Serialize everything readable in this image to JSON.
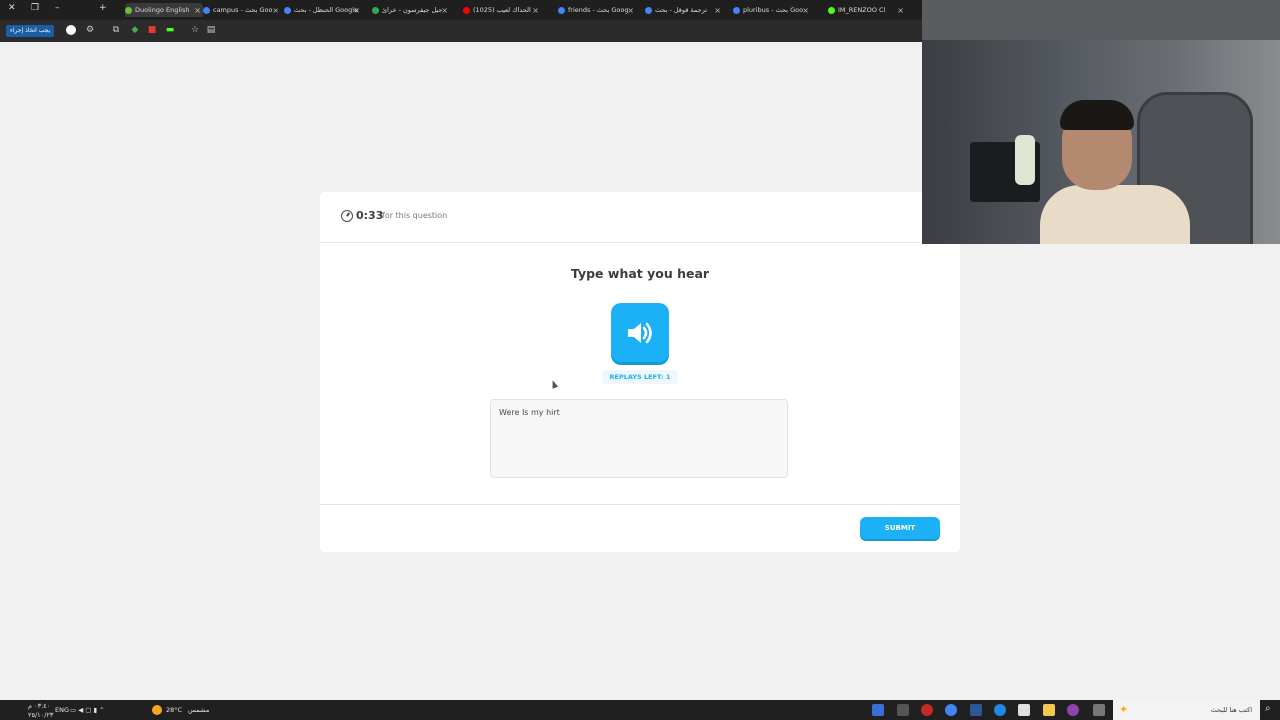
{
  "browser": {
    "tabs": [
      {
        "label": "Duolingo English",
        "active": true,
        "color": "#6bbf3a"
      },
      {
        "label": "campus - بحث Goo",
        "active": false,
        "color": "#4285f4"
      },
      {
        "label": "الحنظل - بحث Google",
        "active": false,
        "color": "#4285f4"
      },
      {
        "label": "جيل جيفرسون - خرائ",
        "active": false,
        "color": "#34a853"
      },
      {
        "label": "(1025) الحداك لعيب",
        "active": false,
        "color": "#ff0000"
      },
      {
        "label": "friends - بحث Goog",
        "active": false,
        "color": "#4285f4"
      },
      {
        "label": "ترجمة قوقل - بحث",
        "active": false,
        "color": "#4285f4"
      },
      {
        "label": "pluribus - بحث Goo",
        "active": false,
        "color": "#4285f4"
      },
      {
        "label": "IM_RENZOO Cl",
        "active": false,
        "color": "#53fc18"
      }
    ],
    "toolbar_action_label": "يجب اتخاذ إجراء"
  },
  "question": {
    "timer": "0:33",
    "timer_caption": "for this question",
    "title": "Type what you hear",
    "replays_label": "REPLAYS LEFT: 1",
    "answer_text": "Were Is my hirt",
    "submit_label": "SUBMIT"
  },
  "taskbar": {
    "weather_temp": "28°C",
    "weather_text": "مشمس",
    "search_placeholder": "اكتب هنا للبحث",
    "language": "ENG",
    "time": "٠٣:٤٠ م",
    "date": "٢٥/١٠/٢٣"
  },
  "colors": {
    "accent": "#1cb0f6",
    "accent_shadow": "#1899d6",
    "page_bg": "#f1f1f1"
  }
}
